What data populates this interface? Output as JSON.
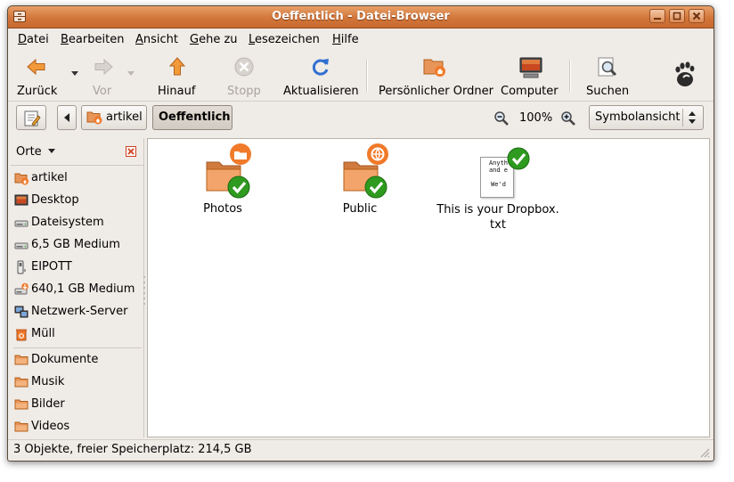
{
  "window": {
    "title": "Oeffentlich - Datei-Browser"
  },
  "menu": [
    "Datei",
    "Bearbeiten",
    "Ansicht",
    "Gehe zu",
    "Lesezeichen",
    "Hilfe"
  ],
  "toolbar": {
    "back": "Zurück",
    "forward": "Vor",
    "up": "Hinauf",
    "stop": "Stopp",
    "reload": "Aktualisieren",
    "home": "Persönlicher Ordner",
    "computer": "Computer",
    "search": "Suchen"
  },
  "location": {
    "crumbs": [
      "artikel",
      "Oeffentlich"
    ],
    "zoom": "100%",
    "view_mode": "Symbolansicht"
  },
  "sidebar": {
    "header": "Orte",
    "places": [
      "artikel",
      "Desktop",
      "Dateisystem",
      "6,5 GB Medium",
      "EIPOTT",
      "640,1 GB Medium",
      "Netzwerk-Server",
      "Müll"
    ],
    "bookmarks": [
      "Dokumente",
      "Musik",
      "Bilder",
      "Videos"
    ]
  },
  "files": [
    {
      "name": "Photos"
    },
    {
      "name": "Public"
    },
    {
      "name": "This is your Dropbox.\ntxt",
      "preview": "Anyth\nand e\n\nWe'd"
    }
  ],
  "status": "3 Objekte, freier Speicherplatz: 214,5 GB",
  "colors": {
    "titlebar": "#d2763a",
    "folder": "#e8955a",
    "check": "#2e9a1f",
    "accent": "#f07a2a"
  }
}
